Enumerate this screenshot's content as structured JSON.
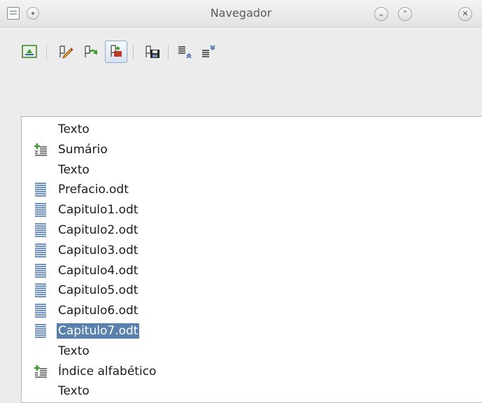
{
  "window": {
    "title": "Navegador",
    "controls": [
      "minimize",
      "maximize",
      "close"
    ]
  },
  "toolbar": {
    "buttons": [
      {
        "icon": "navigation-toggle-icon",
        "active": false
      },
      {
        "icon": "edit-pencil-icon",
        "active": false
      },
      {
        "icon": "update-arrow-icon",
        "active": false
      },
      {
        "icon": "drag-mode-icon",
        "active": true
      },
      {
        "icon": "save-contents-icon",
        "active": false
      },
      {
        "icon": "move-up-icon",
        "active": false
      },
      {
        "icon": "move-down-icon",
        "active": false
      }
    ]
  },
  "tree": {
    "items": [
      {
        "label": "Texto",
        "icon": "none",
        "selected": false
      },
      {
        "label": "Sumário",
        "icon": "index-icon",
        "selected": false
      },
      {
        "label": "Texto",
        "icon": "none",
        "selected": false
      },
      {
        "label": "Prefacio.odt",
        "icon": "section-icon",
        "selected": false
      },
      {
        "label": "Capitulo1.odt",
        "icon": "section-icon",
        "selected": false
      },
      {
        "label": "Capitulo2.odt",
        "icon": "section-icon",
        "selected": false
      },
      {
        "label": "Capitulo3.odt",
        "icon": "section-icon",
        "selected": false
      },
      {
        "label": "Capitulo4.odt",
        "icon": "section-icon",
        "selected": false
      },
      {
        "label": "Capitulo5.odt",
        "icon": "section-icon",
        "selected": false
      },
      {
        "label": "Capitulo6.odt",
        "icon": "section-icon",
        "selected": false
      },
      {
        "label": "Capitulo7.odt",
        "icon": "section-icon",
        "selected": true
      },
      {
        "label": "Texto",
        "icon": "none",
        "selected": false
      },
      {
        "label": "Índice alfabético",
        "icon": "index-icon",
        "selected": false
      },
      {
        "label": "Texto",
        "icon": "none",
        "selected": false
      }
    ]
  },
  "colors": {
    "selection": "#5a80ad",
    "icon_blue": "#3f6fae",
    "icon_green": "#3c9a2e"
  }
}
